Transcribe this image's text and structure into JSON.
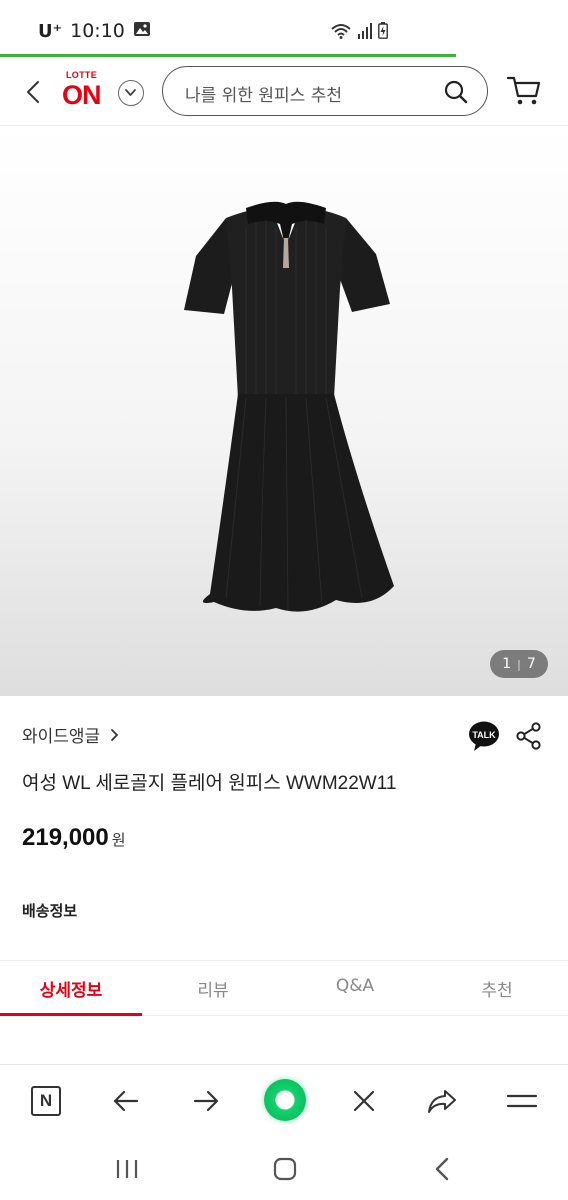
{
  "status_bar": {
    "carrier": "U⁺",
    "time": "10:10"
  },
  "header": {
    "logo_top": "LOTTE",
    "logo_main": "ON",
    "search_placeholder": "나를 위한 원피스 추천"
  },
  "gallery": {
    "current": "1",
    "separator": "|",
    "total": "7"
  },
  "product": {
    "brand": "와이드앵글",
    "title": "여성 WL 세로골지 플레어 원피스 WWM22W11",
    "price": "219,000",
    "price_unit": "원",
    "talk_label": "TALK"
  },
  "delivery": {
    "label": "배송정보"
  },
  "tabs": [
    {
      "label": "상세정보",
      "active": true
    },
    {
      "label": "리뷰",
      "active": false
    },
    {
      "label": "Q&A",
      "active": false
    },
    {
      "label": "추천",
      "active": false
    }
  ],
  "browser_bar": {
    "n_label": "N"
  },
  "colors": {
    "brand_red": "#e60012",
    "load_green": "#3db33d",
    "browser_green": "#0bc160"
  }
}
